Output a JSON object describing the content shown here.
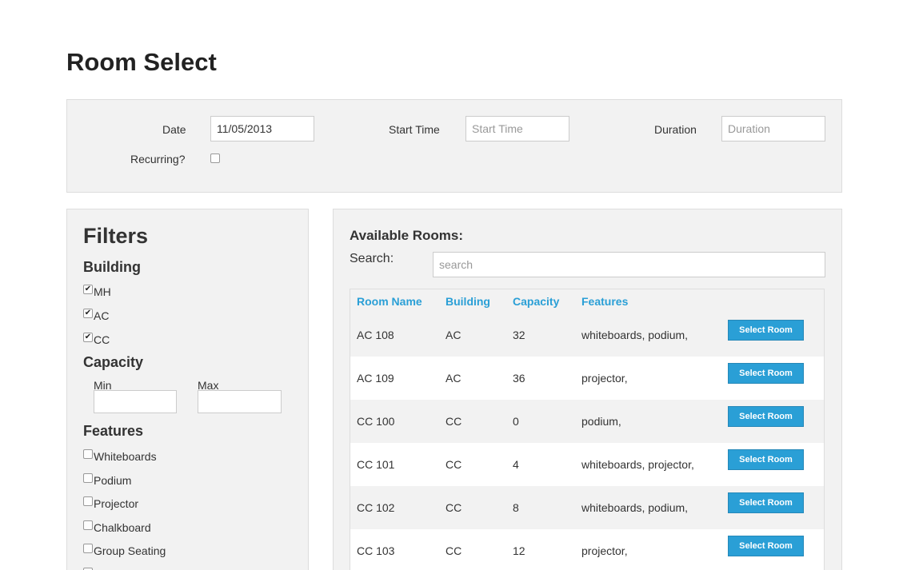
{
  "page": {
    "title": "Room Select"
  },
  "booking": {
    "date_label": "Date",
    "date_value": "11/05/2013",
    "start_time_label": "Start Time",
    "start_time_placeholder": "Start Time",
    "duration_label": "Duration",
    "duration_placeholder": "Duration",
    "recurring_label": "Recurring?",
    "recurring_checked": false
  },
  "filters": {
    "title": "Filters",
    "building_title": "Building",
    "buildings": [
      {
        "label": "MH",
        "checked": true
      },
      {
        "label": "AC",
        "checked": true
      },
      {
        "label": "CC",
        "checked": true
      }
    ],
    "capacity_title": "Capacity",
    "min_label": "Min",
    "max_label": "Max",
    "features_title": "Features",
    "features": [
      {
        "label": "Whiteboards",
        "checked": false
      },
      {
        "label": "Podium",
        "checked": false
      },
      {
        "label": "Projector",
        "checked": false
      },
      {
        "label": "Chalkboard",
        "checked": false
      },
      {
        "label": "Group Seating",
        "checked": false
      }
    ]
  },
  "rooms": {
    "title": "Available Rooms:",
    "search_label": "Search:",
    "search_placeholder": "search",
    "columns": [
      "Room Name",
      "Building",
      "Capacity",
      "Features"
    ],
    "select_label": "Select Room",
    "rows": [
      {
        "name": "AC 108",
        "building": "AC",
        "capacity": "32",
        "features": "whiteboards, podium,"
      },
      {
        "name": "AC 109",
        "building": "AC",
        "capacity": "36",
        "features": "projector,"
      },
      {
        "name": "CC 100",
        "building": "CC",
        "capacity": "0",
        "features": "podium,"
      },
      {
        "name": "CC 101",
        "building": "CC",
        "capacity": "4",
        "features": "whiteboards, projector,"
      },
      {
        "name": "CC 102",
        "building": "CC",
        "capacity": "8",
        "features": "whiteboards, podium,"
      },
      {
        "name": "CC 103",
        "building": "CC",
        "capacity": "12",
        "features": "projector,"
      }
    ]
  }
}
